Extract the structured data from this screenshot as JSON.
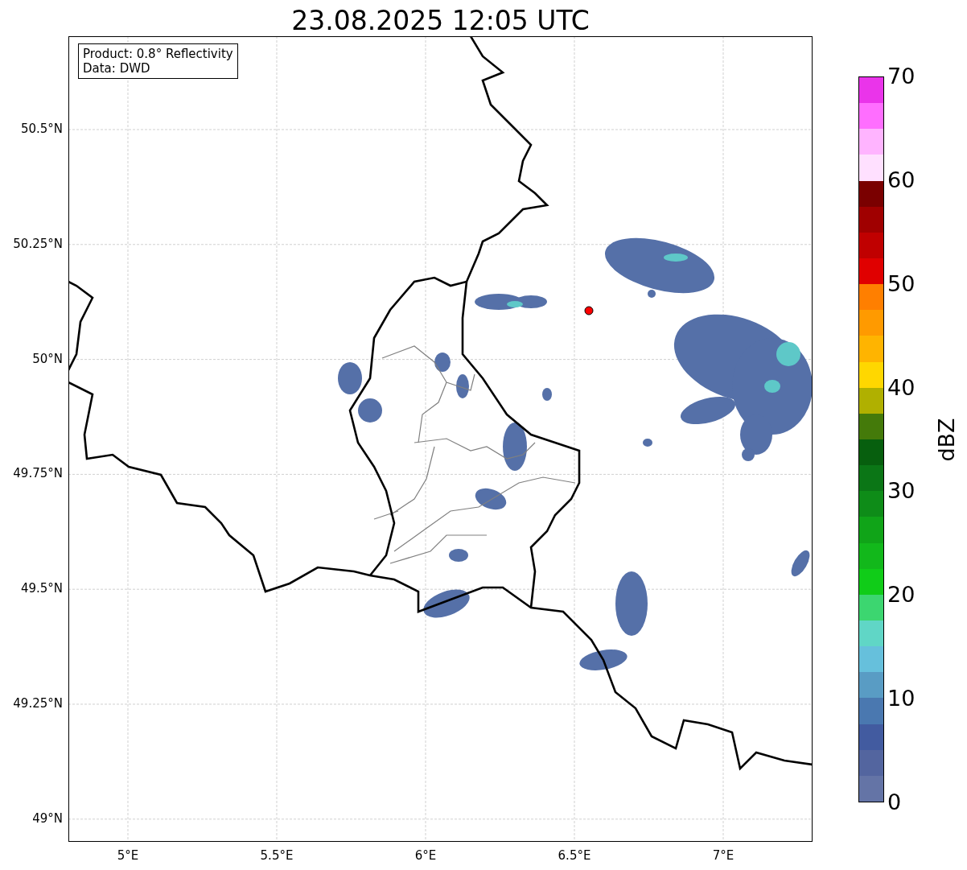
{
  "title": "23.08.2025 12:05 UTC",
  "info_box": [
    "Product: 0.8° Reflectivity",
    "Data: DWD"
  ],
  "map": {
    "x_ticks": [
      "5°E",
      "5.5°E",
      "6°E",
      "6.5°E",
      "7°E"
    ],
    "y_ticks": [
      "50.5°N",
      "50.25°N",
      "50°N",
      "49.75°N",
      "49.5°N",
      "49.25°N",
      "49°N"
    ]
  },
  "colorbar": {
    "label": "dBZ",
    "ticks": [
      "70",
      "60",
      "50",
      "40",
      "30",
      "20",
      "10",
      "0"
    ],
    "segments": [
      {
        "color": "#ea34ea"
      },
      {
        "color": "#ff6eff"
      },
      {
        "color": "#ffb4ff"
      },
      {
        "color": "#ffe0ff"
      },
      {
        "color": "#7a0000"
      },
      {
        "color": "#a00000"
      },
      {
        "color": "#c00000"
      },
      {
        "color": "#e00000"
      },
      {
        "color": "#ff7f00"
      },
      {
        "color": "#ff9a00"
      },
      {
        "color": "#ffb400"
      },
      {
        "color": "#ffd700"
      },
      {
        "color": "#b0b000"
      },
      {
        "color": "#447a0a"
      },
      {
        "color": "#075f0e"
      },
      {
        "color": "#0b7616"
      },
      {
        "color": "#0e8c18"
      },
      {
        "color": "#10a418"
      },
      {
        "color": "#12b81b"
      },
      {
        "color": "#10cc18"
      },
      {
        "color": "#3cd670"
      },
      {
        "color": "#60d6c6"
      },
      {
        "color": "#66c0dc"
      },
      {
        "color": "#599cc4"
      },
      {
        "color": "#4a78b0"
      },
      {
        "color": "#425ba0"
      },
      {
        "color": "#53659f"
      },
      {
        "color": "#6474a6"
      }
    ]
  }
}
